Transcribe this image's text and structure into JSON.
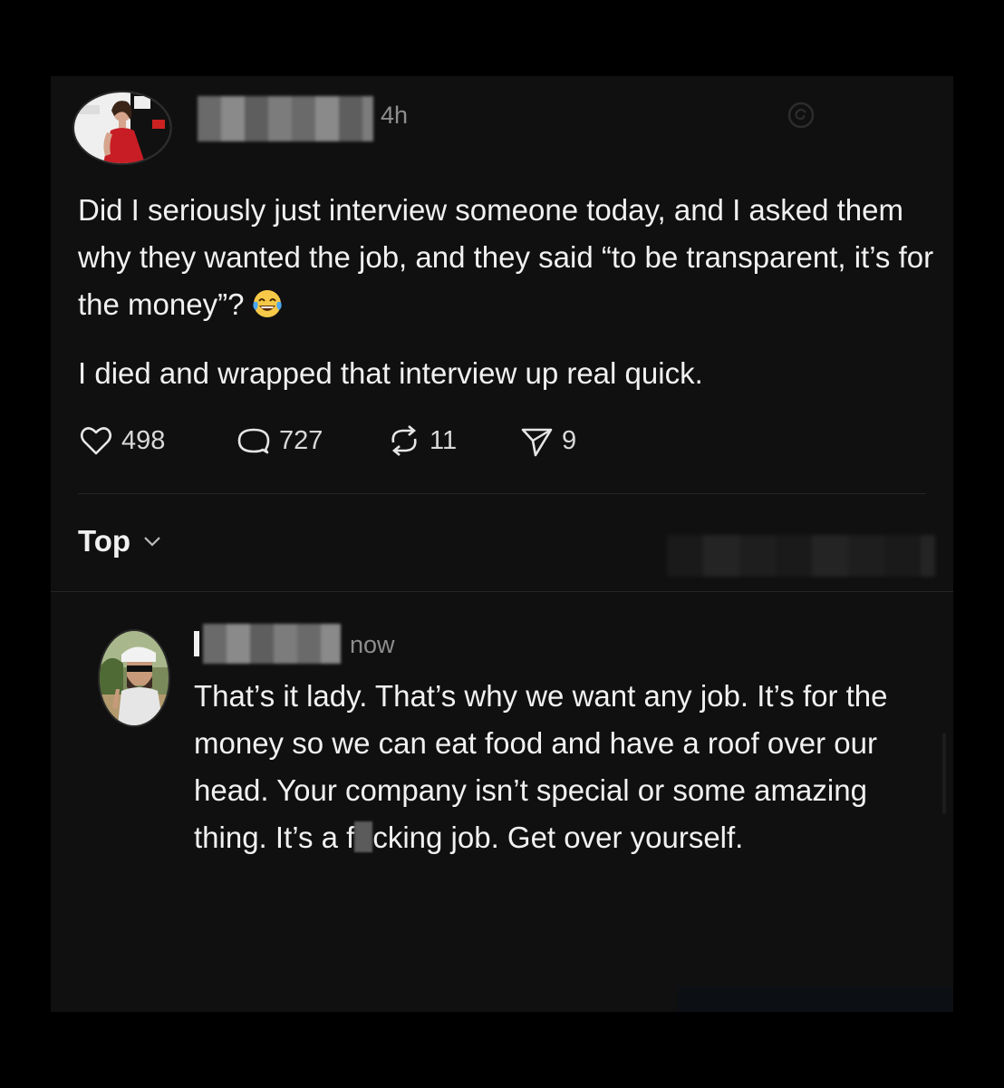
{
  "post": {
    "time": "4h",
    "paragraphs": [
      "Did I seriously just interview someone today, and I asked them why they wanted the job, and they said “to be transparent, it’s for the money”?",
      "I died and wrapped that interview up real quick."
    ],
    "emoji": "face-with-tears-of-joy",
    "counts": {
      "likes": "498",
      "comments": "727",
      "reposts": "11",
      "shares": "9"
    }
  },
  "sort": {
    "label": "Top"
  },
  "reply": {
    "time": "now",
    "text_before": "That’s it lady. That’s why we want any job. It’s for the money so we can eat food and have a roof over our head. Your company isn’t special or some amazing thing. It’s a f",
    "text_after": "cking job. Get over yourself."
  },
  "colors": {
    "background": "#101010",
    "text": "#f1f1f1",
    "muted": "#8e8e8e"
  }
}
